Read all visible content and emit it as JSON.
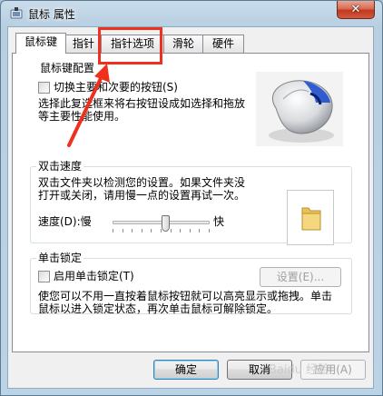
{
  "window": {
    "title": "鼠标 属性",
    "close_glyph": "✕"
  },
  "tabs": [
    {
      "label": "鼠标键",
      "active": true
    },
    {
      "label": "指针",
      "active": false
    },
    {
      "label": "指针选项",
      "active": false
    },
    {
      "label": "滑轮",
      "active": false
    },
    {
      "label": "硬件",
      "active": false
    }
  ],
  "button_config": {
    "title": "鼠标键配置",
    "checkbox_label": "切换主要和次要的按钮(S)",
    "checked": false,
    "description_line1": "选择此复选框来将右按钮设成如选择和拖放",
    "description_line2": "等主要性能使用。"
  },
  "double_click": {
    "title": "双击速度",
    "description_line1": "双击文件夹以检测您的设置。如果文件夹没",
    "description_line2": "打开或关闭，请用慢一点的设置再试一次。",
    "speed_label": "速度(D):慢",
    "fast_label": "快",
    "speed_level": 0.55
  },
  "click_lock": {
    "title": "单击锁定",
    "checkbox_label": "启用单击锁定(T)",
    "checked": false,
    "settings_button": "设置(E)...",
    "description_line1": "使您可以不用一直按着鼠标按钮就可以高亮显示或拖拽。单击",
    "description_line2": "鼠标以进入锁定状态，再次单击鼠标可解除锁定。"
  },
  "footer": {
    "ok": "确定",
    "cancel": "取消",
    "apply": "应用(A)"
  },
  "watermark": "Baidu 经验",
  "colors": {
    "annotation_red": "#f0301e",
    "window_frame": "#b8cfe2"
  }
}
